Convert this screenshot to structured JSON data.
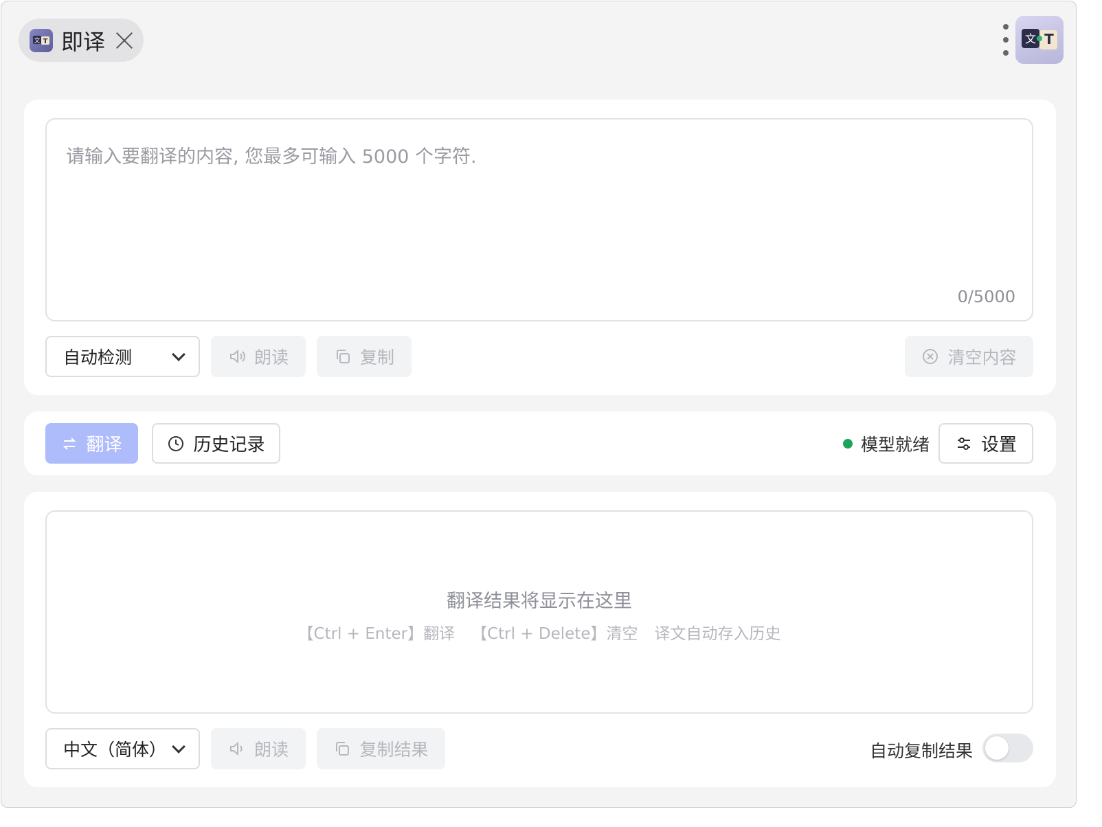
{
  "tab": {
    "title": "即译",
    "icon": "translate-app-icon"
  },
  "header": {
    "menu_icon": "kebab-menu-icon",
    "logo_icon": "translate-app-logo"
  },
  "input": {
    "placeholder": "请输入要翻译的内容, 您最多可输入 5000 个字符.",
    "counter": "0/5000",
    "source_language": "自动检测",
    "speak_label": "朗读",
    "copy_label": "复制",
    "clear_label": "清空内容"
  },
  "actions": {
    "translate_label": "翻译",
    "history_label": "历史记录",
    "status_text": "模型就绪",
    "status_color": "#1fa35a",
    "settings_label": "设置",
    "accent_color": "#aebcfb"
  },
  "output": {
    "placeholder_title": "翻译结果将显示在这里",
    "hints": [
      "【Ctrl + Enter】翻译",
      "【Ctrl + Delete】清空",
      "译文自动存入历史"
    ],
    "target_language": "中文（简体）",
    "speak_label": "朗读",
    "copy_label": "复制结果",
    "auto_copy_label": "自动复制结果",
    "auto_copy_enabled": false
  }
}
